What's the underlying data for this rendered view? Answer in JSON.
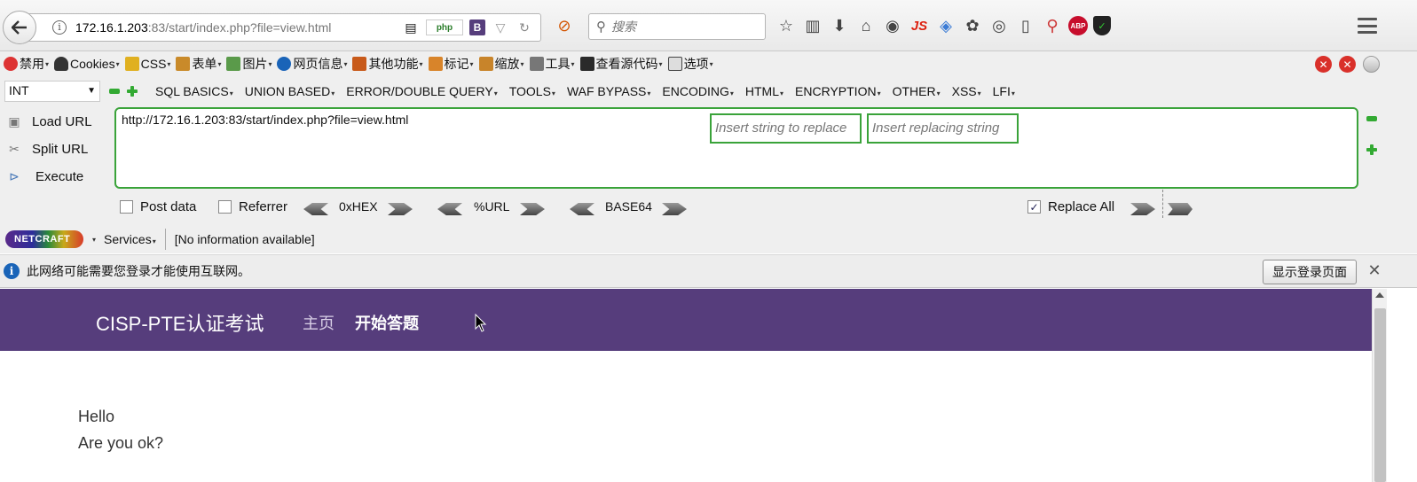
{
  "browser": {
    "url_host": "172.16.1.203",
    "url_rest": ":83/start/index.php?file=view.html",
    "search_placeholder": "搜索",
    "ghp_label": "php",
    "b_label": "B",
    "js_label": "JS",
    "abp_label": "ABP"
  },
  "webdev": {
    "items": [
      "禁用",
      "Cookies",
      "CSS",
      "表单",
      "图片",
      "网页信息",
      "其他功能",
      "标记",
      "缩放",
      "工具",
      "查看源代码",
      "选项"
    ]
  },
  "hackbar": {
    "select_value": "INT",
    "menus": [
      "SQL BASICS",
      "UNION BASED",
      "ERROR/DOUBLE QUERY",
      "TOOLS",
      "WAF BYPASS",
      "ENCODING",
      "HTML",
      "ENCRYPTION",
      "OTHER",
      "XSS",
      "LFI"
    ],
    "load_url": "Load URL",
    "split_url": "Split URL",
    "execute": "Execute",
    "url_value": "http://172.16.1.203:83/start/index.php?file=view.html",
    "post_data": "Post data",
    "referrer": "Referrer",
    "hex": "0xHEX",
    "url_enc": "%URL",
    "base64": "BASE64",
    "replace_placeholder": "Insert string to replace",
    "replacing_placeholder": "Insert replacing string",
    "replace_all": "Replace All",
    "replace_all_checked": true
  },
  "netcraft": {
    "logo": "NETCRAFT",
    "services": "Services",
    "info": "[No information available]"
  },
  "notification": {
    "message": "此网络可能需要您登录才能使用互联网。",
    "button": "显示登录页面"
  },
  "page": {
    "brand": "CISP-PTE认证考试",
    "nav_home": "主页",
    "nav_start": "开始答题",
    "lines": [
      "Hello",
      "Are you ok?"
    ],
    "header_color": "#563d7c"
  }
}
